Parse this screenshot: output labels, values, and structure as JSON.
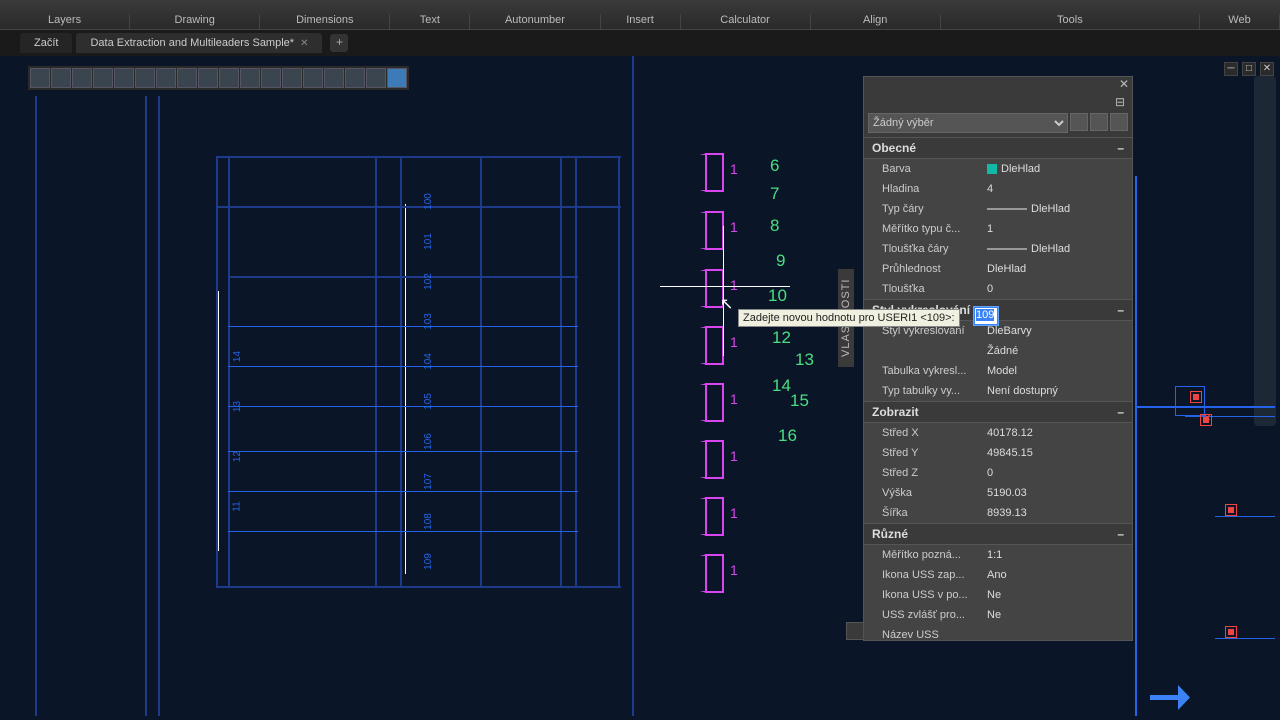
{
  "ribbon": {
    "groups": [
      "Layers",
      "Drawing",
      "Dimensions",
      "Text",
      "Autonumber",
      "Insert",
      "Calculator",
      "Align",
      "Tools",
      "Web"
    ]
  },
  "tabs": {
    "start": "Začít",
    "active": "Data Extraction and Multileaders Sample*",
    "add": "+"
  },
  "canvas": {
    "mag_values": [
      "1",
      "1",
      "1",
      "1",
      "1",
      "1",
      "1",
      "1"
    ],
    "green_numbers": [
      "6",
      "7",
      "8",
      "9",
      "10",
      "12",
      "13",
      "14",
      "15",
      "16"
    ],
    "dim_labels": [
      "100",
      "101",
      "102",
      "103",
      "104",
      "105",
      "106",
      "107",
      "108",
      "109"
    ],
    "left_nums": [
      "11",
      "12",
      "13",
      "14"
    ]
  },
  "tooltip_text": "Zadejte novou hodnotu pro USERI1 <109>:",
  "edit_value": "109",
  "panel": {
    "vtab": "VLASTNOSTI",
    "filter": "Žádný výběr",
    "sections": {
      "general": "Obecné",
      "plot": "Styl vykreslování",
      "view": "Zobrazit",
      "misc": "Různé"
    },
    "general": [
      {
        "k": "Barva",
        "v": "DleHlad",
        "sw": true
      },
      {
        "k": "Hladina",
        "v": "4"
      },
      {
        "k": "Typ čáry",
        "v": "DleHlad",
        "line": true
      },
      {
        "k": "Měřítko typu č...",
        "v": "1"
      },
      {
        "k": "Tloušťka čáry",
        "v": "DleHlad",
        "line": true
      },
      {
        "k": "Průhlednost",
        "v": "DleHlad"
      },
      {
        "k": "Tloušťka",
        "v": "0"
      }
    ],
    "plot": [
      {
        "k": "Styl vykreslování",
        "v": "DleBarvy"
      },
      {
        "k": "",
        "v": "Žádné"
      },
      {
        "k": "Tabulka vykresl...",
        "v": "Model"
      },
      {
        "k": "Typ tabulky vy...",
        "v": "Není dostupný"
      }
    ],
    "view": [
      {
        "k": "Střed X",
        "v": "40178.12"
      },
      {
        "k": "Střed Y",
        "v": "49845.15"
      },
      {
        "k": "Střed Z",
        "v": "0"
      },
      {
        "k": "Výška",
        "v": "5190.03"
      },
      {
        "k": "Šířka",
        "v": "8939.13"
      }
    ],
    "misc": [
      {
        "k": "Měřítko pozná...",
        "v": "1:1"
      },
      {
        "k": "Ikona USS zap...",
        "v": "Ano"
      },
      {
        "k": "Ikona USS v po...",
        "v": "Ne"
      },
      {
        "k": "USS zvlášť pro...",
        "v": "Ne"
      },
      {
        "k": "Název USS",
        "v": ""
      }
    ]
  }
}
